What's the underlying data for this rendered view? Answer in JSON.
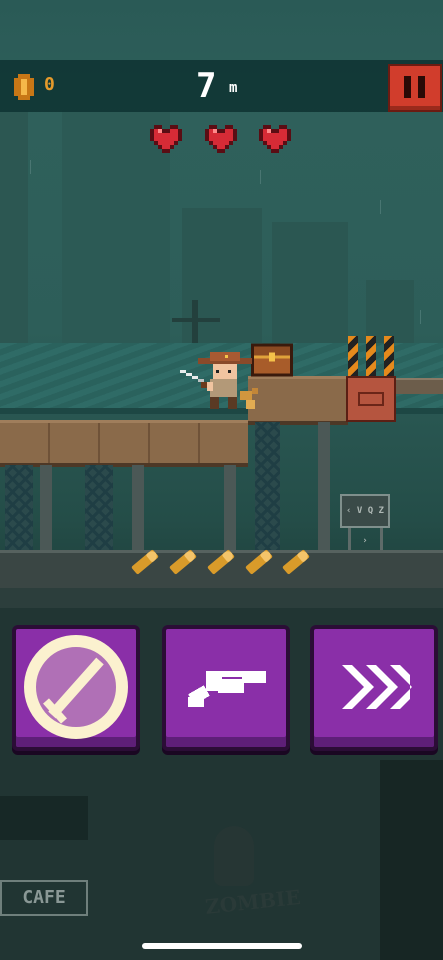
{
  "hud": {
    "coin_icon": "coin-icon",
    "coin_count": "0",
    "distance_value": "7",
    "distance_unit": "m",
    "pause_icon": "pause-icon"
  },
  "lives": {
    "hearts": 3,
    "icon": "heart-icon",
    "color": "#d62b36"
  },
  "pickups": {
    "ammo_count": 5,
    "icon": "bullet-icon"
  },
  "abilities": [
    {
      "id": "sword",
      "icon": "sword-icon",
      "state": "cooldown-ring"
    },
    {
      "id": "gun",
      "icon": "revolver-icon",
      "state": "ready"
    },
    {
      "id": "dash",
      "icon": "fast-forward-icon",
      "state": "ready"
    }
  ],
  "scenery": {
    "sign_text": "‹ V Q Z ›",
    "cafe_sign": "CAFE",
    "graffiti": "ZOMBIE"
  },
  "colors": {
    "accent_purple": "#8a2fa8",
    "pause_red": "#d13d2c",
    "coin_orange": "#e59a2b"
  }
}
